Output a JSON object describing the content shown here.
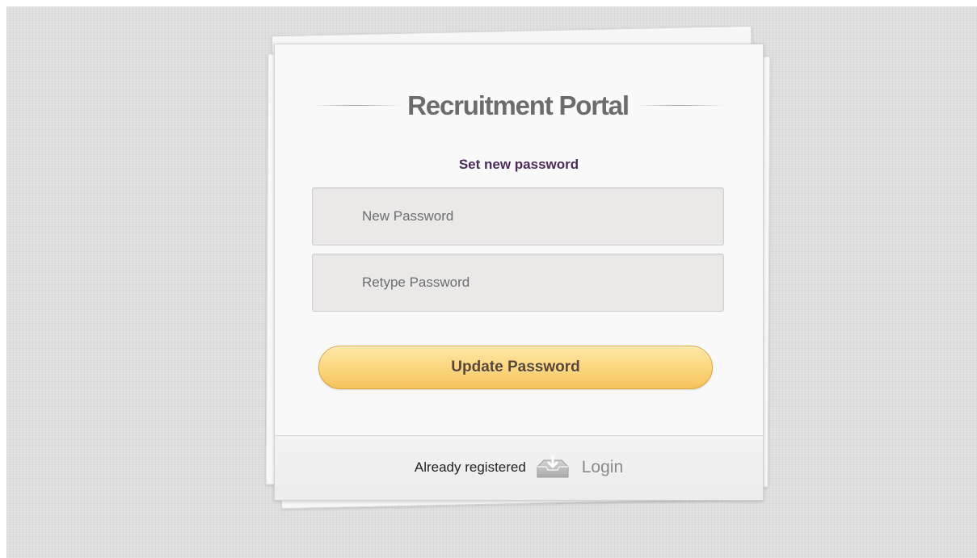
{
  "portal": {
    "title": "Recruitment Portal",
    "subtitle": "Set new password"
  },
  "form": {
    "new_password_placeholder": "New Password",
    "retype_password_placeholder": "Retype Password",
    "submit_label": "Update Password"
  },
  "footer": {
    "already_registered_text": "Already registered",
    "login_icon": "login-tray-icon",
    "login_label": "Login"
  },
  "colors": {
    "subtitle": "#4b2d58",
    "button_top": "#fde7a7",
    "button_bottom": "#f6c35c",
    "title": "#6c6c6c"
  }
}
